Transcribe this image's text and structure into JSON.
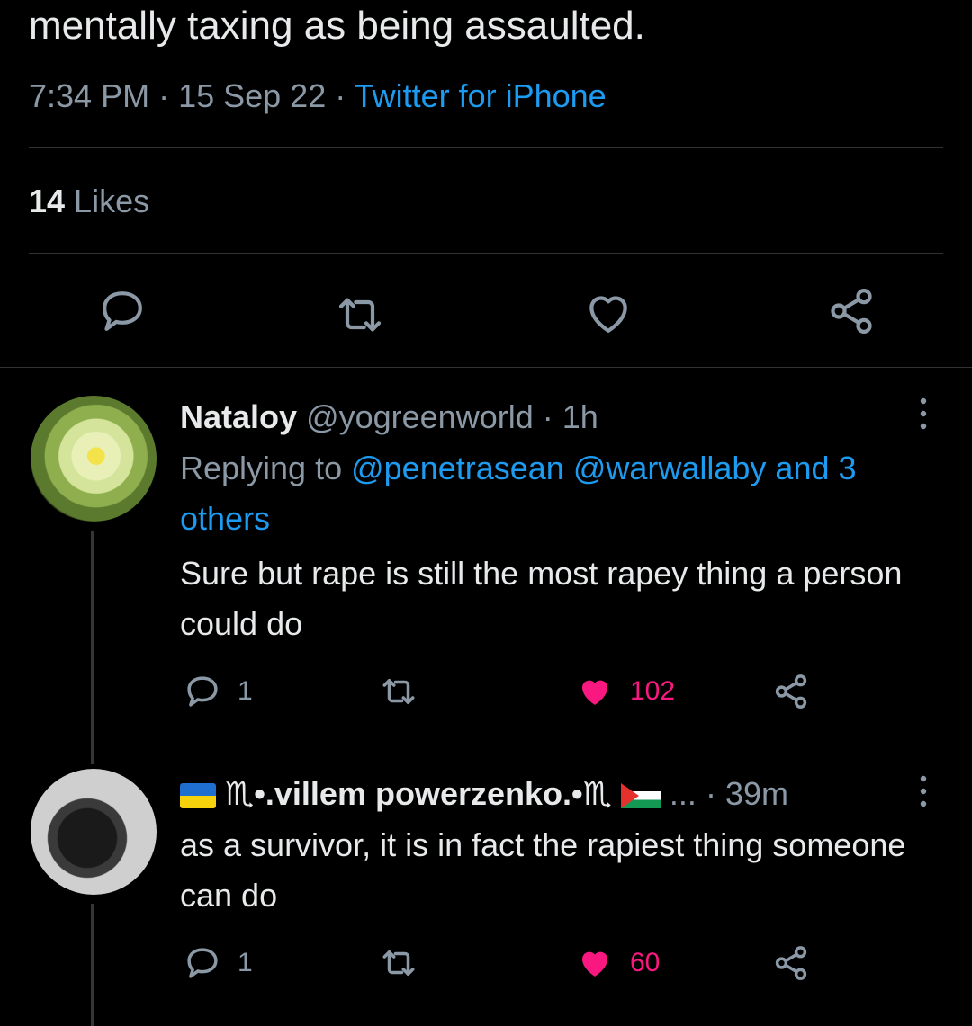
{
  "tweet": {
    "text_tail": "mentally taxing as being assaulted.",
    "time": "7:34 PM",
    "sep1": " · ",
    "date": "15 Sep 22",
    "sep2": " · ",
    "source": "Twitter for iPhone",
    "likes_count": "14",
    "likes_label": " Likes"
  },
  "icons": {
    "reply": "reply-icon",
    "retweet": "retweet-icon",
    "like": "heart-icon",
    "share": "share-icon",
    "more": "more-vertical-icon"
  },
  "replies": [
    {
      "display_name": "Nataloy",
      "handle": "@yogreenworld",
      "time": "1h",
      "replying_prefix": "Replying to ",
      "replying_links": "@penetrasean @warwallaby and 3 others",
      "text": "Sure but rape is still the most rapey thing a person could do",
      "reply_count": "1",
      "like_count": "102",
      "liked": true
    },
    {
      "display_name": "♏•.villem powerzenko.•♏",
      "handle_trunc": "...",
      "time": "39m",
      "text": "as a survivor, it is in fact the rapiest thing someone can do",
      "reply_count": "1",
      "like_count": "60",
      "liked": true
    }
  ],
  "colors": {
    "background": "#000000",
    "text": "#e7e9ea",
    "muted": "#8b98a5",
    "link": "#1d9bf0",
    "like": "#f91880",
    "divider": "#2f3336"
  }
}
